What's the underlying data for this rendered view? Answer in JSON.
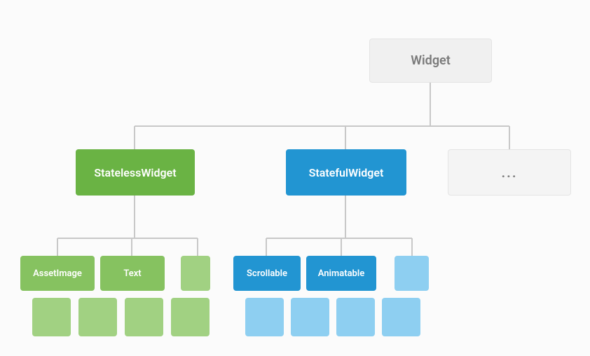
{
  "root": {
    "label": "Widget"
  },
  "ellipsis": {
    "label": "..."
  },
  "stateless": {
    "label": "StatelessWidget",
    "children": {
      "c1": "AssetImage",
      "c2": "Text"
    }
  },
  "stateful": {
    "label": "StatefulWidget",
    "children": {
      "c1": "Scrollable",
      "c2": "Animatable"
    }
  },
  "colors": {
    "green_main": "#6ab344",
    "green_leaf": "#86c260",
    "green_blank": "#a1d182",
    "blue_main": "#2295d2",
    "blue_blank": "#8ecff1",
    "neutral_bg": "#f0f0f0",
    "neutral_border": "#e4e4e4",
    "connector": "#c8c8c8"
  }
}
